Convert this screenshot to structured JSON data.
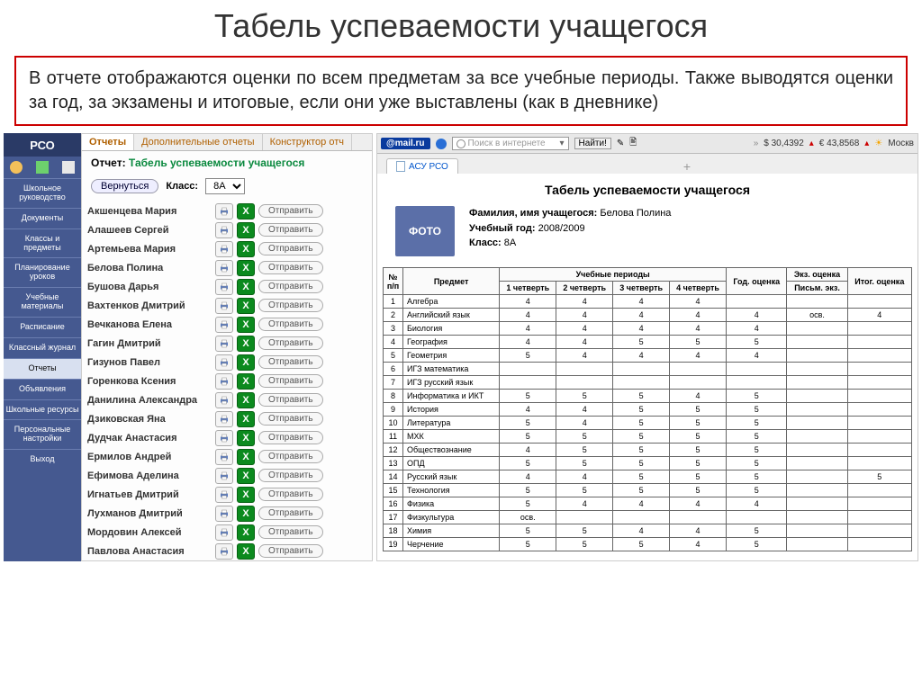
{
  "page_title": "Табель успеваемости учащегося",
  "description": "В отчете отображаются оценки по всем предметам за все учебные периоды. Также выводятся оценки за год, за экзамены и итоговые, если они уже выставлены (как в дневнике)",
  "sidebar": {
    "logo": "РСО",
    "items": [
      {
        "label": "Школьное руководство",
        "active": false
      },
      {
        "label": "Документы",
        "active": false
      },
      {
        "label": "Классы и предметы",
        "active": false
      },
      {
        "label": "Планирование уроков",
        "active": false
      },
      {
        "label": "Учебные материалы",
        "active": false
      },
      {
        "label": "Расписание",
        "active": false
      },
      {
        "label": "Классный журнал",
        "active": false
      },
      {
        "label": "Отчеты",
        "active": true
      },
      {
        "label": "Объявления",
        "active": false
      },
      {
        "label": "Школьные ресурсы",
        "active": false
      },
      {
        "label": "Персональные настройки",
        "active": false
      },
      {
        "label": "Выход",
        "active": false
      }
    ]
  },
  "tabs": [
    {
      "label": "Отчеты",
      "active": true
    },
    {
      "label": "Дополнительные отчеты",
      "active": false
    },
    {
      "label": "Конструктор отч",
      "active": false
    }
  ],
  "report_header": {
    "label": "Отчет:",
    "value": "Табель успеваемости учащегося"
  },
  "controls": {
    "back": "Вернуться",
    "class_label": "Класс:",
    "class_value": "8А"
  },
  "send_label": "Отправить",
  "excel_glyph": "X",
  "students": [
    "Акшенцева Мария",
    "Алашеев Сергей",
    "Артемьева Мария",
    "Белова Полина",
    "Бушова Дарья",
    "Вахтенков Дмитрий",
    "Вечканова Елена",
    "Гагин Дмитрий",
    "Гизунов Павел",
    "Горенкова Ксения",
    "Данилина Александра",
    "Дзиковская Яна",
    "Дудчак Анастасия",
    "Ермилов Андрей",
    "Ефимова Аделина",
    "Игнатьев Дмитрий",
    "Лухманов Дмитрий",
    "Мордовин Алексей",
    "Павлова Анастасия"
  ],
  "right": {
    "mail": "@mail.ru",
    "search_placeholder": "Поиск в интернете",
    "find": "Найти!",
    "rate1": "$ 30,4392",
    "rate2": "€ 43,8568",
    "weather": "Москв",
    "doc_tab": "АСУ РСО",
    "plus": "+",
    "title": "Табель успеваемости учащегося",
    "photo": "ФОТО",
    "info": {
      "name_lbl": "Фамилия, имя учащегося:",
      "name": "Белова Полина",
      "year_lbl": "Учебный год:",
      "year": "2008/2009",
      "class_lbl": "Класс:",
      "class": "8А"
    },
    "headers": {
      "num": "№ п/п",
      "subj": "Предмет",
      "periods": "Учебные периоды",
      "q1": "1 четверть",
      "q2": "2 четверть",
      "q3": "3 четверть",
      "q4": "4 четверть",
      "year": "Год. оценка",
      "exam": "Экз. оценка",
      "exam_sub": "Письм. экз.",
      "final": "Итог. оценка"
    },
    "rows": [
      {
        "n": "1",
        "s": "Алгебра",
        "g": [
          "4",
          "4",
          "4",
          "4",
          "",
          "",
          ""
        ]
      },
      {
        "n": "2",
        "s": "Английский язык",
        "g": [
          "4",
          "4",
          "4",
          "4",
          "4",
          "осв.",
          "4"
        ]
      },
      {
        "n": "3",
        "s": "Биология",
        "g": [
          "4",
          "4",
          "4",
          "4",
          "4",
          "",
          ""
        ]
      },
      {
        "n": "4",
        "s": "География",
        "g": [
          "4",
          "4",
          "5",
          "5",
          "5",
          "",
          ""
        ]
      },
      {
        "n": "5",
        "s": "Геометрия",
        "g": [
          "5",
          "4",
          "4",
          "4",
          "4",
          "",
          ""
        ]
      },
      {
        "n": "6",
        "s": "ИГЗ математика",
        "g": [
          "",
          "",
          "",
          "",
          "",
          "",
          ""
        ]
      },
      {
        "n": "7",
        "s": "ИГЗ русский язык",
        "g": [
          "",
          "",
          "",
          "",
          "",
          "",
          ""
        ]
      },
      {
        "n": "8",
        "s": "Информатика и ИКТ",
        "g": [
          "5",
          "5",
          "5",
          "4",
          "5",
          "",
          ""
        ]
      },
      {
        "n": "9",
        "s": "История",
        "g": [
          "4",
          "4",
          "5",
          "5",
          "5",
          "",
          ""
        ]
      },
      {
        "n": "10",
        "s": "Литература",
        "g": [
          "5",
          "4",
          "5",
          "5",
          "5",
          "",
          ""
        ]
      },
      {
        "n": "11",
        "s": "МХК",
        "g": [
          "5",
          "5",
          "5",
          "5",
          "5",
          "",
          ""
        ]
      },
      {
        "n": "12",
        "s": "Обществознание",
        "g": [
          "4",
          "5",
          "5",
          "5",
          "5",
          "",
          ""
        ]
      },
      {
        "n": "13",
        "s": "ОПД",
        "g": [
          "5",
          "5",
          "5",
          "5",
          "5",
          "",
          ""
        ]
      },
      {
        "n": "14",
        "s": "Русский язык",
        "g": [
          "4",
          "4",
          "5",
          "5",
          "5",
          "",
          "5"
        ]
      },
      {
        "n": "15",
        "s": "Технология",
        "g": [
          "5",
          "5",
          "5",
          "5",
          "5",
          "",
          ""
        ]
      },
      {
        "n": "16",
        "s": "Физика",
        "g": [
          "5",
          "4",
          "4",
          "4",
          "4",
          "",
          ""
        ]
      },
      {
        "n": "17",
        "s": "Физкультура",
        "g": [
          "осв.",
          "",
          "",
          "",
          "",
          "",
          ""
        ]
      },
      {
        "n": "18",
        "s": "Химия",
        "g": [
          "5",
          "5",
          "4",
          "4",
          "5",
          "",
          ""
        ]
      },
      {
        "n": "19",
        "s": "Черчение",
        "g": [
          "5",
          "5",
          "5",
          "4",
          "5",
          "",
          ""
        ]
      }
    ]
  }
}
